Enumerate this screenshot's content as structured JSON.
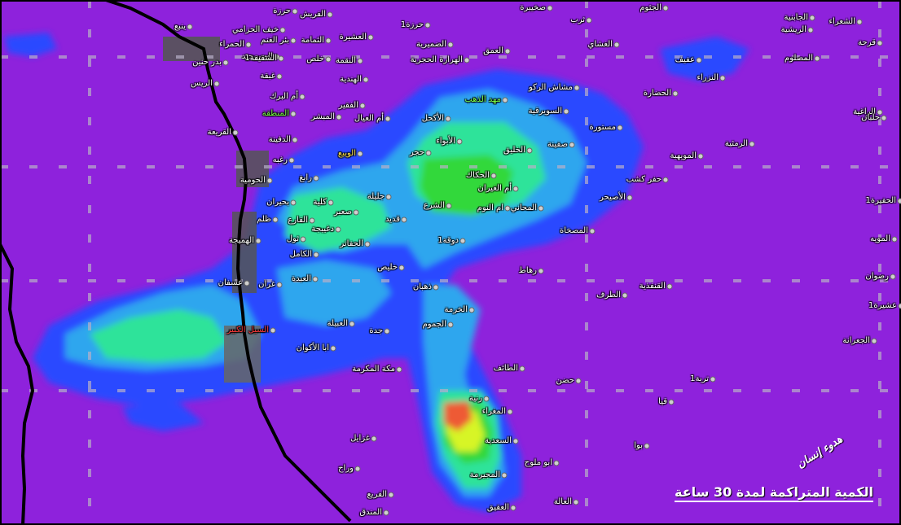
{
  "caption": "الكمية المتراكمة لمدة 30 ساعة",
  "watermark": "هدوء إنسان",
  "colors": {
    "background": "#8e22dc",
    "light_rain": "#2c48ff",
    "moderate_rain": "#2fa6ee",
    "heavy_rain": "#2fe39a",
    "very_heavy_rain": "#30d83a",
    "intense_rain": "#d7f526",
    "extreme_rain": "#ee5a34",
    "land_border": "#000000",
    "urban_area": "#555555"
  },
  "places": [
    {
      "name": "ينبع"
    },
    {
      "name": "بدر حنين"
    },
    {
      "name": "حرزة"
    },
    {
      "name": "الفريش"
    },
    {
      "name": "خيف الحزامي"
    },
    {
      "name": "الحمراء"
    },
    {
      "name": "المسيجيد"
    },
    {
      "name": "الثمامة"
    },
    {
      "name": "بئر الغنم"
    },
    {
      "name": "العشيرة"
    },
    {
      "name": "حرزة1"
    },
    {
      "name": "الضميرية"
    },
    {
      "name": "صخيبرة"
    },
    {
      "name": "ثرب"
    },
    {
      "name": "الجثوم"
    },
    {
      "name": "الجابنية"
    },
    {
      "name": "الشعراء"
    },
    {
      "name": "الريشية"
    },
    {
      "name": "قرحة"
    },
    {
      "name": "الشقيقة1"
    },
    {
      "name": "خلص"
    },
    {
      "name": "النقمة"
    },
    {
      "name": "الهرارة الحجرية"
    },
    {
      "name": "العمق"
    },
    {
      "name": "الغشاي"
    },
    {
      "name": "عفيف"
    },
    {
      "name": "المصلوم"
    },
    {
      "name": "الريس"
    },
    {
      "name": "غبقة"
    },
    {
      "name": "الهندية"
    },
    {
      "name": "مشاش الركو"
    },
    {
      "name": "النزراء"
    },
    {
      "name": "أم البرك"
    },
    {
      "name": "المنطقة"
    },
    {
      "name": "مهد الذهب"
    },
    {
      "name": "الحضارة"
    },
    {
      "name": "الفقير"
    },
    {
      "name": "المبشر"
    },
    {
      "name": "أم العيال"
    },
    {
      "name": "الأكحل"
    },
    {
      "name": "السويرقية"
    },
    {
      "name": "الراغية"
    },
    {
      "name": "حلبان"
    },
    {
      "name": "القريعة"
    },
    {
      "name": "مستورة"
    },
    {
      "name": "الدفينة"
    },
    {
      "name": "الأبواء"
    },
    {
      "name": "صفينة"
    },
    {
      "name": "الرمثية"
    },
    {
      "name": "رغبه"
    },
    {
      "name": "الويبع"
    },
    {
      "name": "حجر"
    },
    {
      "name": "الخليق"
    },
    {
      "name": "المويهية"
    },
    {
      "name": "الحومية"
    },
    {
      "name": "رابغ"
    },
    {
      "name": "الحكاك"
    },
    {
      "name": "أم الغيران"
    },
    {
      "name": "حفر كشب"
    },
    {
      "name": "الحفيرة1"
    },
    {
      "name": "بحيران"
    },
    {
      "name": "كلية"
    },
    {
      "name": "جليلة"
    },
    {
      "name": "الشرع"
    },
    {
      "name": "الأصيحر"
    },
    {
      "name": "ظلم"
    },
    {
      "name": "صعبر"
    },
    {
      "name": "القارع"
    },
    {
      "name": "قديد"
    },
    {
      "name": "المحاني"
    },
    {
      "name": "ام النوم"
    },
    {
      "name": "دغيبجة"
    },
    {
      "name": "المصخاة"
    },
    {
      "name": "المويه"
    },
    {
      "name": "الهميجة"
    },
    {
      "name": "ثول"
    },
    {
      "name": "دوقة1"
    },
    {
      "name": "الحفاتر"
    },
    {
      "name": "الكامل"
    },
    {
      "name": "خليص"
    },
    {
      "name": "رهاط"
    },
    {
      "name": "رضوان"
    },
    {
      "name": "العبدة"
    },
    {
      "name": "غران"
    },
    {
      "name": "عسفان"
    },
    {
      "name": "ذهبان"
    },
    {
      "name": "القنفذية"
    },
    {
      "name": "الطرف"
    },
    {
      "name": "الخرمة"
    },
    {
      "name": "عشيرة1"
    },
    {
      "name": "العبيلة"
    },
    {
      "name": "الجموم"
    },
    {
      "name": "السيل الكبير"
    },
    {
      "name": "جدة"
    },
    {
      "name": "الجعرانة"
    },
    {
      "name": "ابا الأكوان"
    },
    {
      "name": "مكة المكرمة"
    },
    {
      "name": "الطائف"
    },
    {
      "name": "حضن"
    },
    {
      "name": "تربة1"
    },
    {
      "name": "رنية"
    },
    {
      "name": "قيا"
    },
    {
      "name": "المغراء"
    },
    {
      "name": "غزايل"
    },
    {
      "name": "السعدية"
    },
    {
      "name": "بوا"
    },
    {
      "name": "ابو ملوح"
    },
    {
      "name": "وراح"
    },
    {
      "name": "المجيرمة"
    },
    {
      "name": "الفريع"
    },
    {
      "name": "العالة"
    },
    {
      "name": "العقيق"
    },
    {
      "name": "المندق"
    },
    {
      "name": "الليث"
    }
  ]
}
